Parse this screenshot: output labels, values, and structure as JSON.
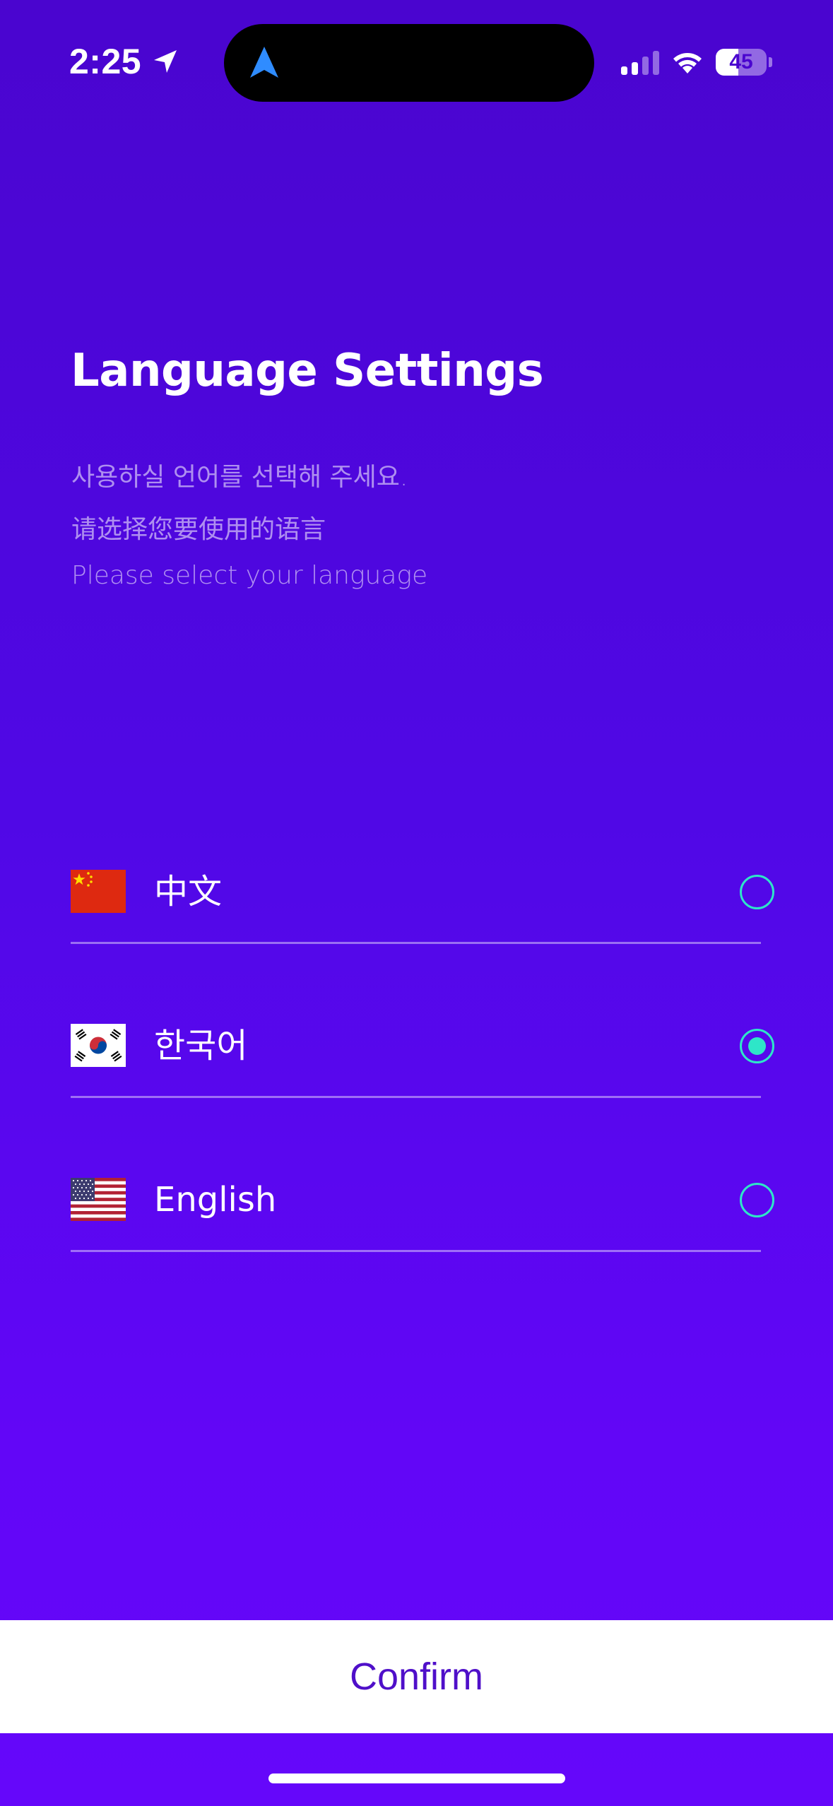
{
  "status_bar": {
    "time": "2:25",
    "location_icon": "location-arrow-icon",
    "island_icon": "navigation-arrow-icon",
    "signal_bars_active": 2,
    "signal_bars_total": 4,
    "wifi_icon": "wifi-icon",
    "battery_percent": "45",
    "battery_level": 0.45
  },
  "header": {
    "title": "Language Settings",
    "subtitle_ko": "사용하실 언어를 선택해 주세요.",
    "subtitle_zh": "请选择您要使用的语言",
    "subtitle_en": "Please select your language"
  },
  "languages": [
    {
      "label": "中文",
      "flag_icon": "china-flag-icon",
      "selected": false
    },
    {
      "label": "한국어",
      "flag_icon": "south-korea-flag-icon",
      "selected": true
    },
    {
      "label": "English",
      "flag_icon": "usa-flag-icon",
      "selected": false
    }
  ],
  "confirm": {
    "label": "Confirm"
  },
  "colors": {
    "background_top": "#4a05cf",
    "background_bottom": "#6507fa",
    "accent_radio": "#2ee6c8",
    "confirm_text": "#4f0fc9"
  }
}
